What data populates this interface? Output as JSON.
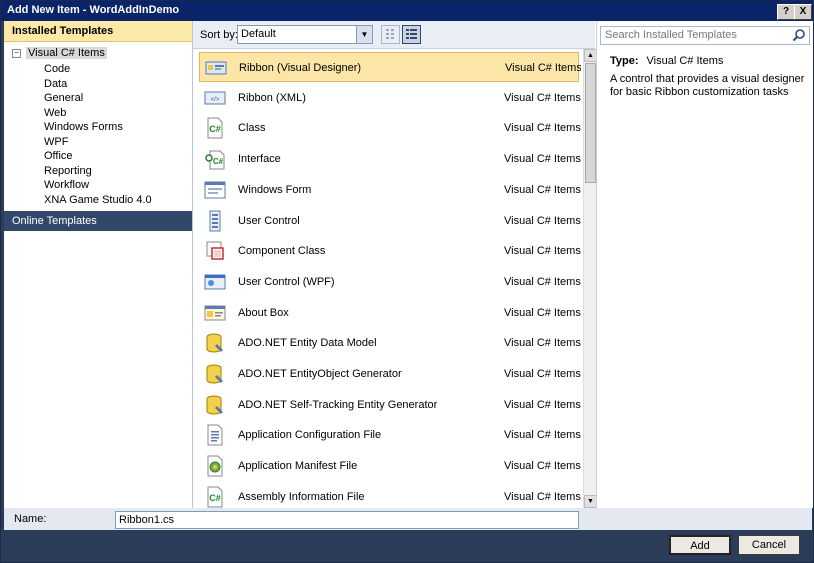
{
  "window": {
    "title": "Add New Item - WordAddInDemo",
    "help_label": "?",
    "close_label": "X"
  },
  "left": {
    "header": "Installed Templates",
    "root_toggle": "−",
    "root": "Visual C# Items",
    "children": [
      "Code",
      "Data",
      "General",
      "Web",
      "Windows Forms",
      "WPF",
      "Office",
      "Reporting",
      "Workflow",
      "XNA Game Studio 4.0"
    ],
    "online": "Online Templates"
  },
  "toolbar": {
    "sort_label": "Sort by:",
    "sort_value": "Default"
  },
  "templates": [
    {
      "name": "Ribbon (Visual Designer)",
      "category": "Visual C# Items",
      "icon": "ribbon-icon",
      "selected": true
    },
    {
      "name": "Ribbon (XML)",
      "category": "Visual C# Items",
      "icon": "ribbon-xml-icon"
    },
    {
      "name": "Class",
      "category": "Visual C# Items",
      "icon": "csharp-class-icon"
    },
    {
      "name": "Interface",
      "category": "Visual C# Items",
      "icon": "interface-icon"
    },
    {
      "name": "Windows Form",
      "category": "Visual C# Items",
      "icon": "windows-form-icon"
    },
    {
      "name": "User Control",
      "category": "Visual C# Items",
      "icon": "user-control-icon"
    },
    {
      "name": "Component Class",
      "category": "Visual C# Items",
      "icon": "component-class-icon"
    },
    {
      "name": "User Control (WPF)",
      "category": "Visual C# Items",
      "icon": "wpf-user-control-icon"
    },
    {
      "name": "About Box",
      "category": "Visual C# Items",
      "icon": "about-box-icon"
    },
    {
      "name": "ADO.NET Entity Data Model",
      "category": "Visual C# Items",
      "icon": "database-icon"
    },
    {
      "name": "ADO.NET EntityObject Generator",
      "category": "Visual C# Items",
      "icon": "database-icon"
    },
    {
      "name": "ADO.NET Self-Tracking Entity Generator",
      "category": "Visual C# Items",
      "icon": "database-icon"
    },
    {
      "name": "Application Configuration File",
      "category": "Visual C# Items",
      "icon": "config-file-icon"
    },
    {
      "name": "Application Manifest File",
      "category": "Visual C# Items",
      "icon": "manifest-file-icon"
    },
    {
      "name": "Assembly Information File",
      "category": "Visual C# Items",
      "icon": "csharp-file-icon"
    }
  ],
  "search": {
    "placeholder": "Search Installed Templates"
  },
  "details": {
    "type_label": "Type:",
    "type_value": "Visual C# Items",
    "description": "A control that provides a visual designer for basic Ribbon customization tasks"
  },
  "name_field": {
    "label": "Name:",
    "value": "Ribbon1.cs"
  },
  "buttons": {
    "add": "Add",
    "cancel": "Cancel"
  }
}
